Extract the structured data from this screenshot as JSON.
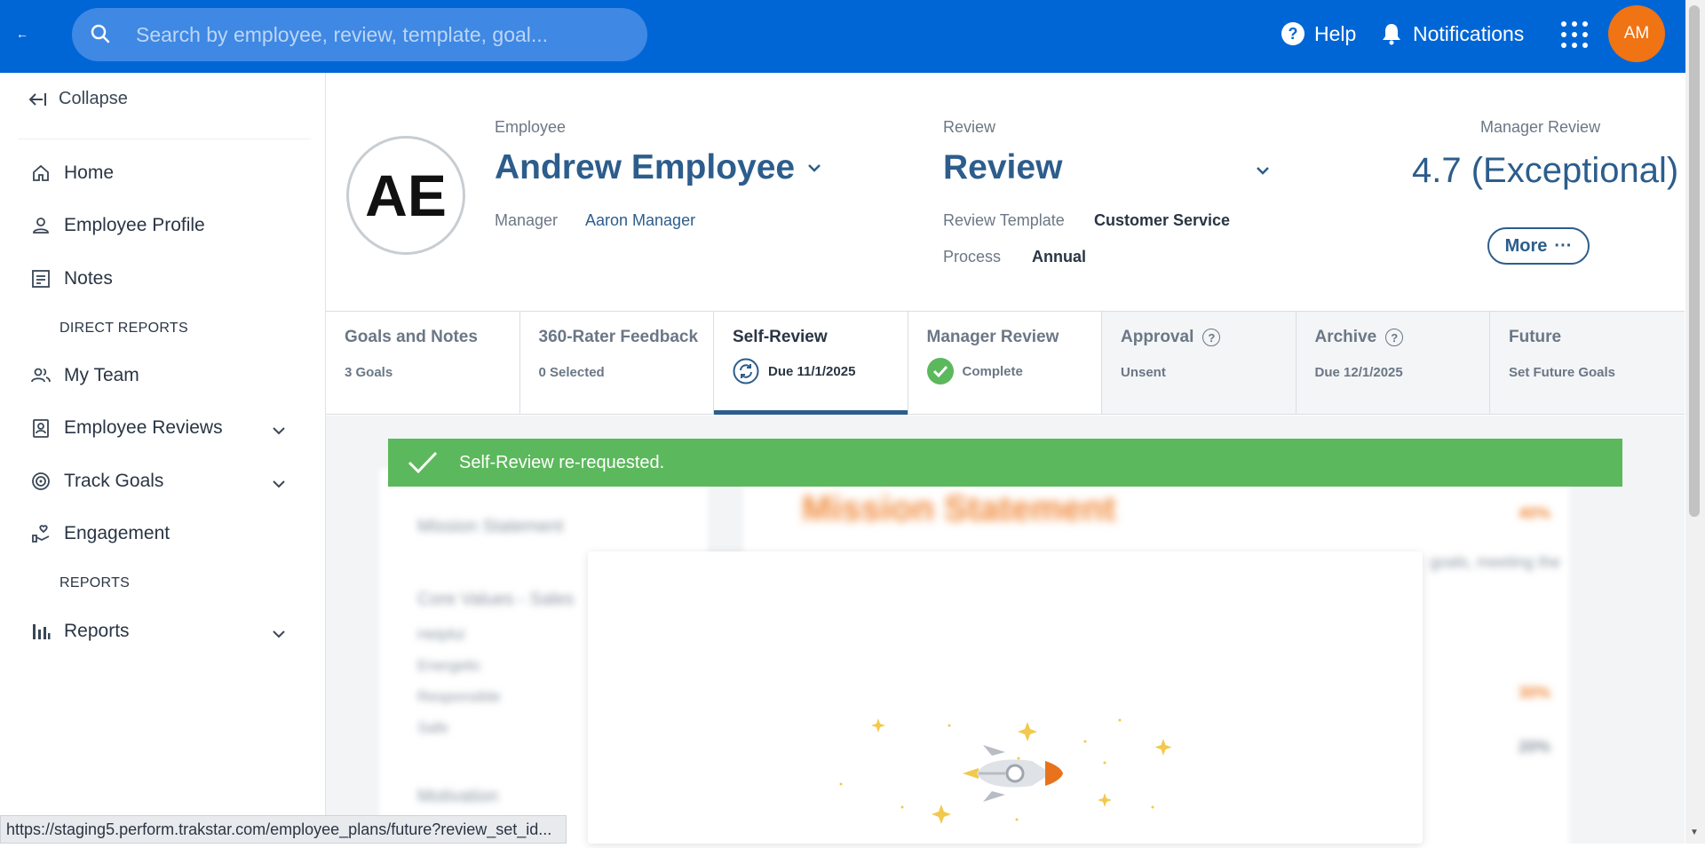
{
  "topbar": {
    "back_label": "←",
    "search_placeholder": "Search by employee, review, template, goal...",
    "help_label": "Help",
    "notifications_label": "Notifications",
    "user_initials": "AM",
    "brand_color": "#0066d6"
  },
  "sidebar": {
    "collapse_label": "Collapse",
    "items": [
      {
        "label": "Home",
        "icon": "home-icon"
      },
      {
        "label": "Employee Profile",
        "icon": "person-icon"
      },
      {
        "label": "Notes",
        "icon": "notes-icon"
      },
      {
        "label": "My Team",
        "icon": "team-icon"
      },
      {
        "label": "Employee Reviews",
        "icon": "review-badge-icon"
      },
      {
        "label": "Track Goals",
        "icon": "target-icon"
      },
      {
        "label": "Engagement",
        "icon": "engagement-icon"
      },
      {
        "label": "Reports",
        "icon": "bar-chart-icon"
      }
    ],
    "section_direct_reports": "DIRECT REPORTS",
    "section_reports": "REPORTS"
  },
  "header": {
    "employee_initials": "AE",
    "employee_label": "Employee",
    "employee_name": "Andrew Employee",
    "manager_label": "Manager",
    "manager_name": "Aaron Manager",
    "review_label": "Review",
    "review_title": "Review",
    "template_label": "Review Template",
    "template_value": "Customer Service",
    "process_label": "Process",
    "process_value": "Annual",
    "manager_review_label": "Manager Review",
    "manager_review_score": "4.7 (Exceptional)",
    "more_label": "More"
  },
  "tabs": [
    {
      "title": "Goals and Notes",
      "sub": "3 Goals"
    },
    {
      "title": "360-Rater Feedback",
      "sub": "0 Selected"
    },
    {
      "title": "Self-Review",
      "sub": "Due 11/1/2025"
    },
    {
      "title": "Manager Review",
      "sub": "Complete"
    },
    {
      "title": "Approval",
      "sub": "Unsent"
    },
    {
      "title": "Archive",
      "sub": "Due 12/1/2025"
    },
    {
      "title": "Future",
      "sub": "Set Future Goals"
    }
  ],
  "toast": {
    "message": "Self-Review re-requested.",
    "color": "#5cb85c"
  },
  "background": {
    "mission_heading": "Mission Statement",
    "mission_sidebar": "Mission Statement",
    "core_values": "Core Values - Sales",
    "items": [
      "Helpful",
      "Energetic",
      "Responsible",
      "Safe"
    ],
    "motivation": "Motivation",
    "pct": "40%",
    "pct2": "30%",
    "pct3": "20%",
    "snippet": "goals, meeting the"
  },
  "status_url": "https://staging5.perform.trakstar.com/employee_plans/future?review_set_id..."
}
